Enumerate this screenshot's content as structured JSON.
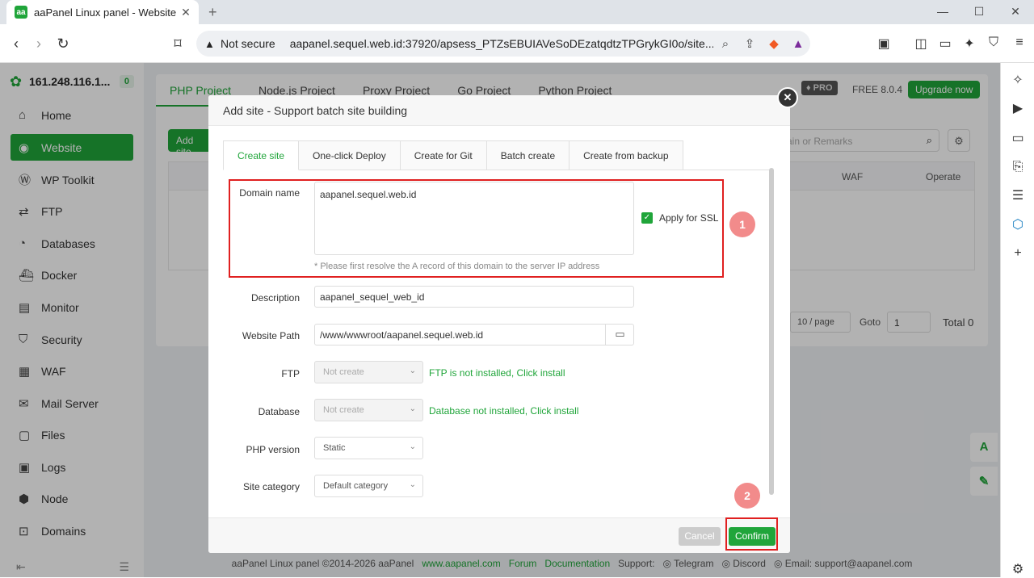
{
  "browser": {
    "tab_title": "aaPanel Linux panel - Website",
    "favicon_text": "aa",
    "not_secure": "Not secure",
    "url": "aapanel.sequel.web.id:37920/apsess_PTZsEBUIAVeSoDEzatqdtzTPGrykGI0o/site..."
  },
  "sidebar": {
    "server_ip": "161.248.116.1...",
    "server_badge": "0",
    "items": [
      {
        "label": "Home",
        "icon": "home-icon"
      },
      {
        "label": "Website",
        "icon": "globe-icon"
      },
      {
        "label": "WP Toolkit",
        "icon": "wordpress-icon"
      },
      {
        "label": "FTP",
        "icon": "ftp-icon"
      },
      {
        "label": "Databases",
        "icon": "database-icon"
      },
      {
        "label": "Docker",
        "icon": "docker-icon"
      },
      {
        "label": "Monitor",
        "icon": "monitor-icon"
      },
      {
        "label": "Security",
        "icon": "shield-icon"
      },
      {
        "label": "WAF",
        "icon": "waf-icon"
      },
      {
        "label": "Mail Server",
        "icon": "mail-icon"
      },
      {
        "label": "Files",
        "icon": "folder-icon"
      },
      {
        "label": "Logs",
        "icon": "logs-icon"
      },
      {
        "label": "Node",
        "icon": "node-icon"
      },
      {
        "label": "Domains",
        "icon": "domains-icon"
      }
    ],
    "active_index": 1
  },
  "main": {
    "project_tabs": [
      "PHP Project",
      "Node.js Project",
      "Proxy Project",
      "Go Project",
      "Python Project"
    ],
    "pro_label": "PRO",
    "free_version": "FREE  8.0.4",
    "upgrade_label": "Upgrade now",
    "add_site_label": "Add site",
    "search_placeholder": "ain or Remarks",
    "col_waf": "WAF",
    "col_operate": "Operate",
    "page_size": "10 / page",
    "goto_label": "Goto",
    "goto_value": "1",
    "total": "Total 0"
  },
  "footer": {
    "copyright": "aaPanel Linux panel ©2014-2026 aaPanel",
    "site": "www.aapanel.com",
    "forum": "Forum",
    "docs": "Documentation",
    "support": "Support:",
    "telegram": "Telegram",
    "discord": "Discord",
    "email": "Email: support@aapanel.com"
  },
  "modal": {
    "title": "Add site - Support batch site building",
    "tabs": [
      "Create site",
      "One-click Deploy",
      "Create for Git",
      "Batch create",
      "Create from backup"
    ],
    "domain_label": "Domain name",
    "domain_value": "aapanel.sequel.web.id",
    "ssl_label": "Apply for SSL",
    "domain_hint": "* Please first resolve the A record of this domain to the server IP address",
    "description_label": "Description",
    "description_value": "aapanel_sequel_web_id",
    "path_label": "Website Path",
    "path_value": "/www/wwwroot/aapanel.sequel.web.id",
    "ftp_label": "FTP",
    "ftp_value": "Not create",
    "ftp_link": "FTP is not installed, Click install",
    "db_label": "Database",
    "db_value": "Not create",
    "db_link": "Database not installed, Click install",
    "php_label": "PHP version",
    "php_value": "Static",
    "category_label": "Site category",
    "category_value": "Default category",
    "cancel": "Cancel",
    "confirm": "Confirm"
  },
  "annotations": {
    "mark1": "1",
    "mark2": "2"
  },
  "colors": {
    "accent": "#20a53a",
    "highlight": "#e02020"
  }
}
